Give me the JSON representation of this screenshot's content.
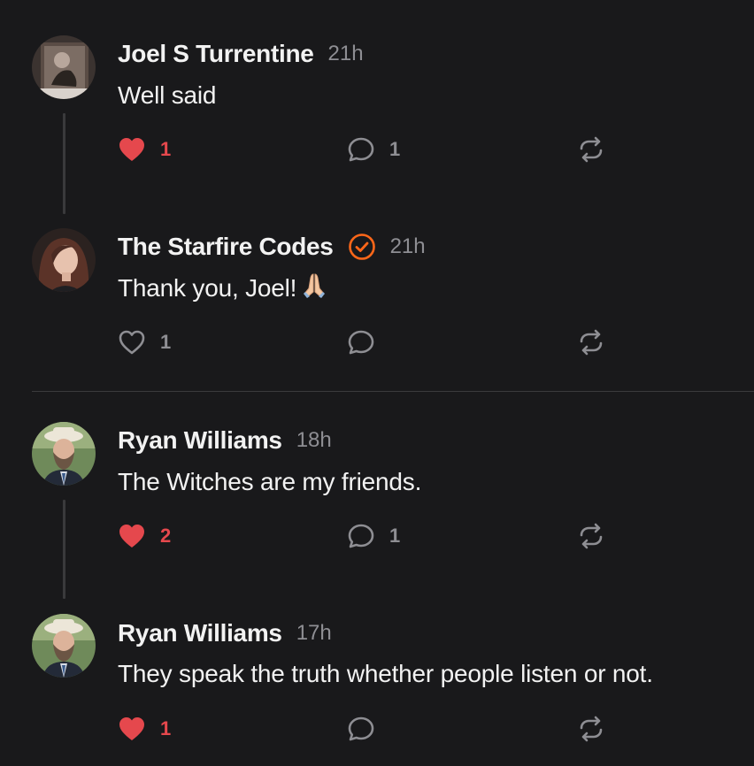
{
  "comments": [
    {
      "author": "Joel S Turrentine",
      "time": "21h",
      "text": "Well said",
      "like_count": "1",
      "reply_count": "1",
      "liked": true,
      "verified": false
    },
    {
      "author": "The Starfire Codes",
      "time": "21h",
      "text": "Thank you, Joel!",
      "emoji": "folded-hands",
      "like_count": "1",
      "reply_count": "",
      "liked": false,
      "verified": true
    },
    {
      "author": "Ryan Williams",
      "time": "18h",
      "text": "The Witches are my friends.",
      "like_count": "2",
      "reply_count": "1",
      "liked": true,
      "verified": false
    },
    {
      "author": "Ryan Williams",
      "time": "17h",
      "text": "They speak the truth whether people listen or not.",
      "like_count": "1",
      "reply_count": "",
      "liked": true,
      "verified": false
    }
  ],
  "icons": {
    "like": "heart-icon",
    "reply": "speech-bubble-icon",
    "restack": "restack-icon",
    "verified": "verified-check-badge-icon"
  },
  "colors": {
    "background": "#19191b",
    "liked": "#e5484d",
    "muted": "#8e8e93",
    "verified": "#ff6719",
    "divider": "#3a3a3c"
  }
}
